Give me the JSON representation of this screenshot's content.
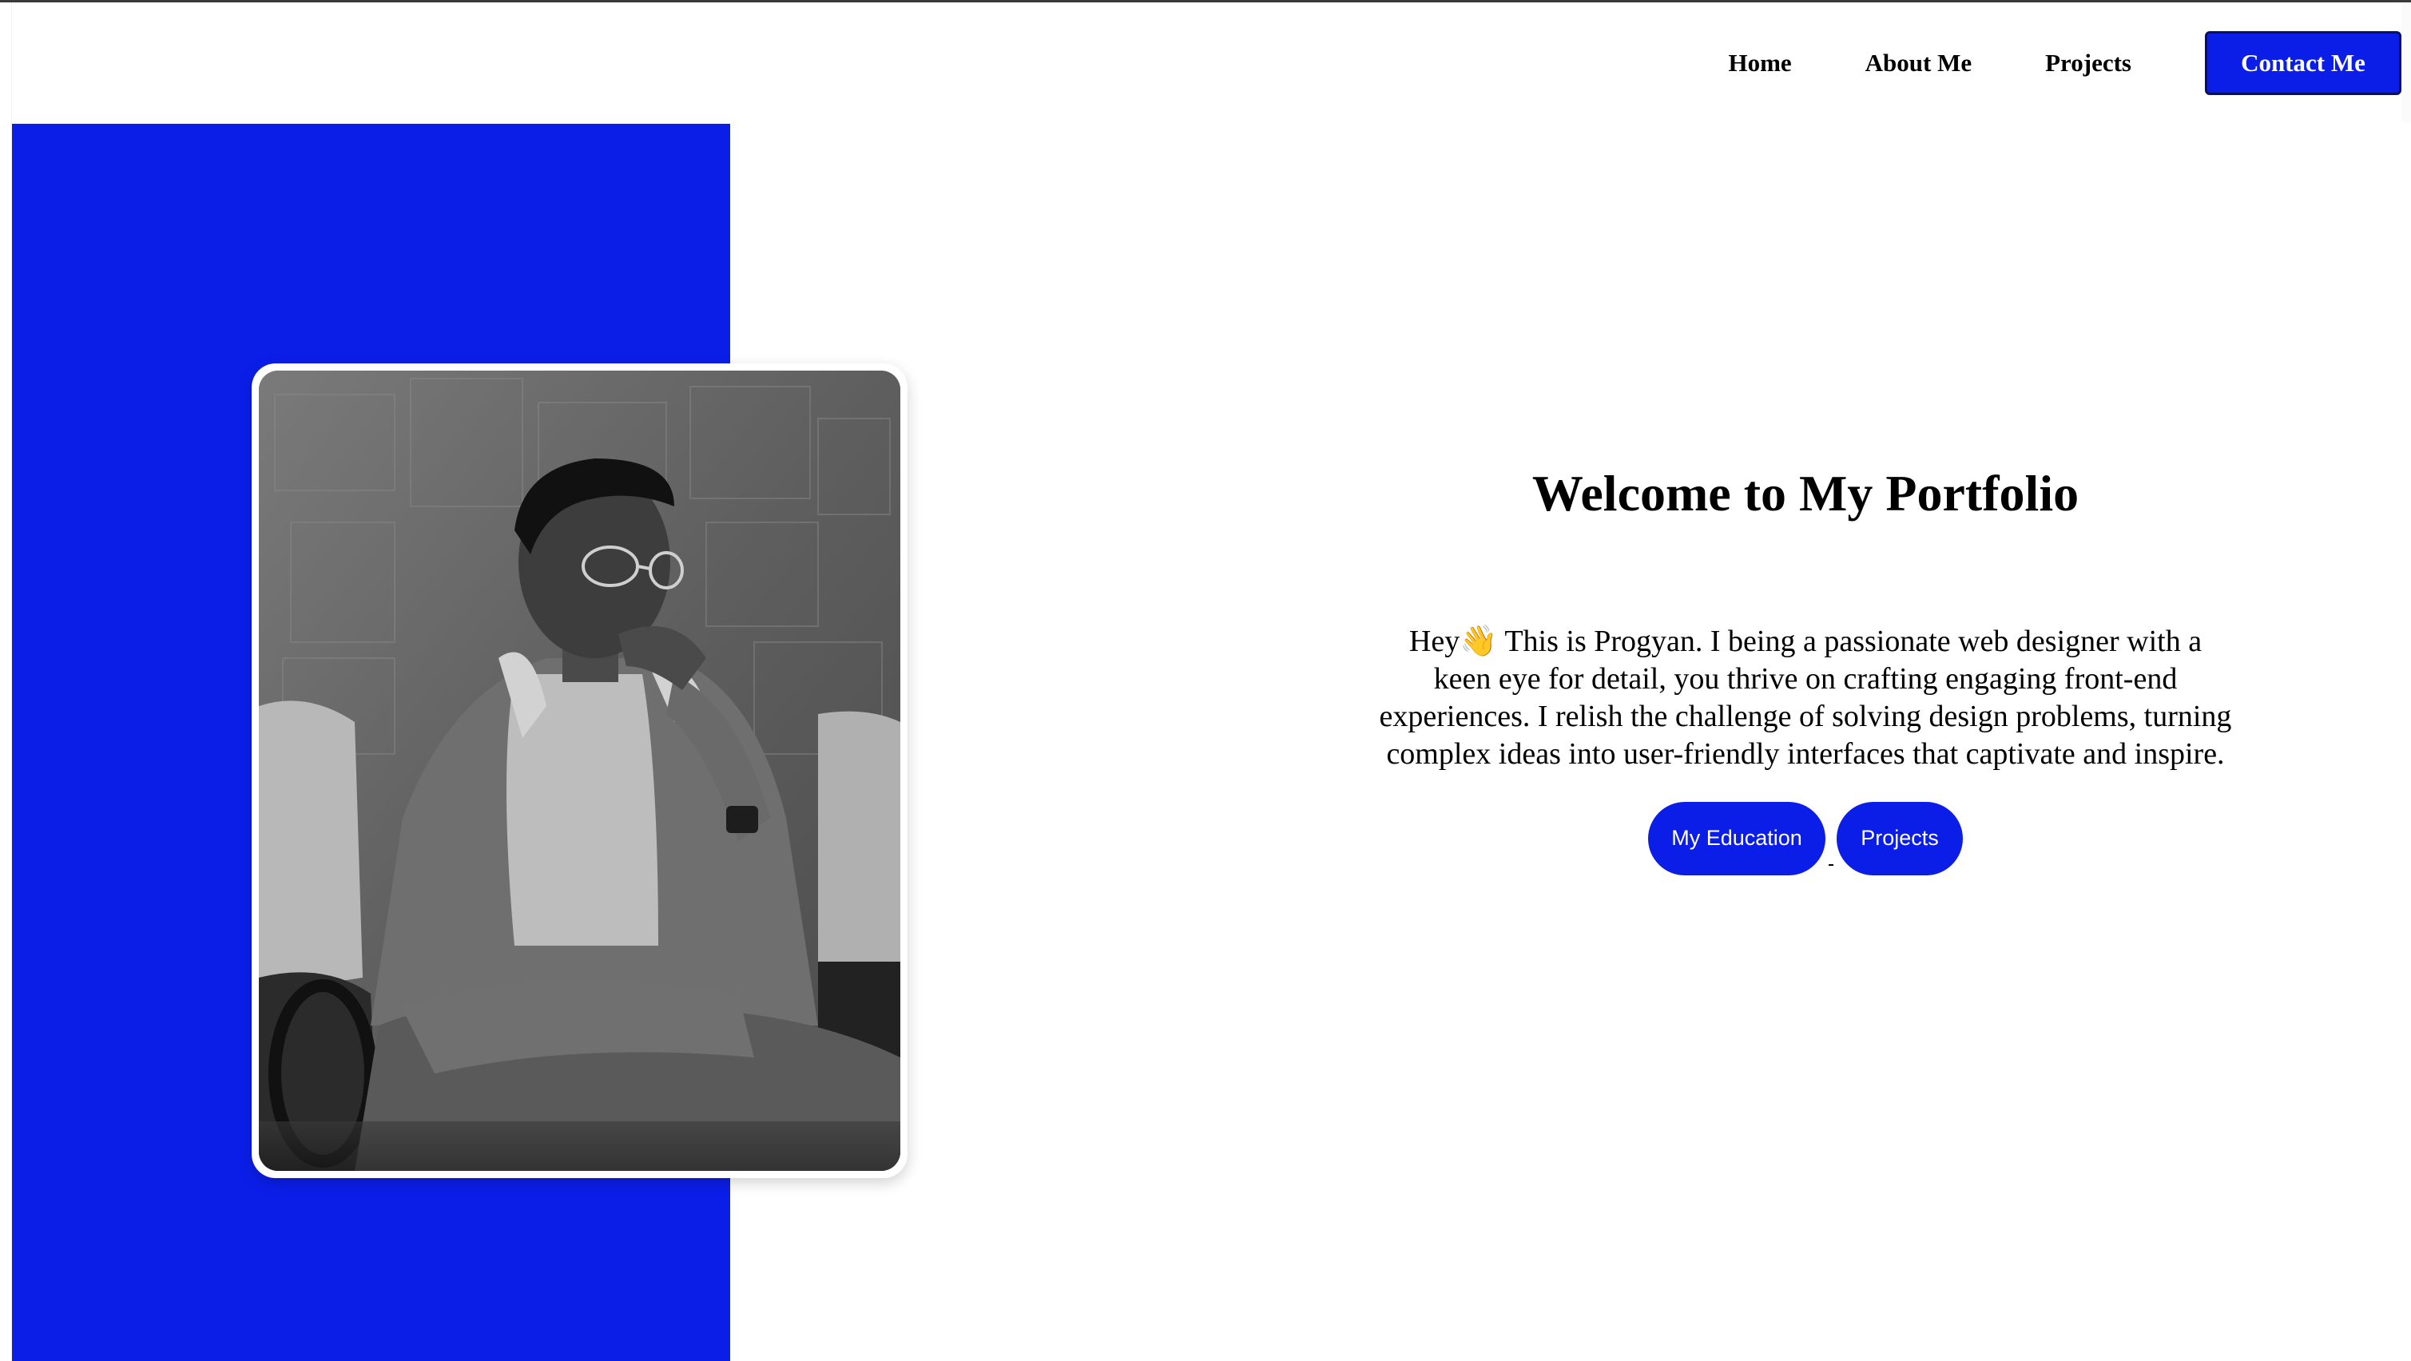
{
  "nav": {
    "links": [
      {
        "label": "Home"
      },
      {
        "label": "About Me"
      },
      {
        "label": "Projects"
      }
    ],
    "cta_label": "Contact Me"
  },
  "hero": {
    "title": "Welcome to My Portfolio",
    "intro": "Hey👋 This is Progyan. I being a passionate web designer with a keen eye for detail, you thrive on crafting engaging front-end experiences. I relish the challenge of solving design problems, turning complex ideas into user-friendly interfaces that captivate and inspire.",
    "buttons": {
      "education_label": "My Education",
      "projects_label": "Projects"
    }
  },
  "colors": {
    "accent": "#0b1ee8",
    "text": "#000000",
    "background": "#ffffff"
  },
  "photo": {
    "subject": "profile-photo-black-and-white"
  }
}
